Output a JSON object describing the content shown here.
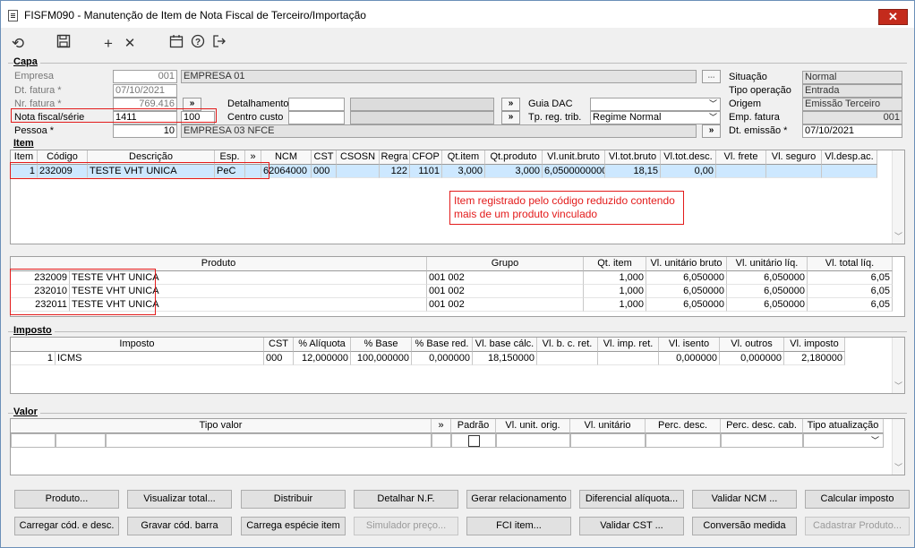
{
  "window": {
    "title": "FISFM090 - Manutenção de Item de Nota Fiscal de Terceiro/Importação",
    "close": "✕"
  },
  "toolbar": {
    "refresh": "⟲",
    "save": "💾",
    "add": "+",
    "cancel": "✕",
    "calendar": "▦",
    "help": "?",
    "exit": "⇥"
  },
  "capa": {
    "title": "Capa",
    "empresa": {
      "label": "Empresa",
      "code": "001",
      "name": "EMPRESA 01",
      "btn": "..."
    },
    "dt_fatura": {
      "label": "Dt. fatura *",
      "value": "07/10/2021"
    },
    "nr_fatura": {
      "label": "Nr. fatura *",
      "value": "769.416",
      "btn": "»"
    },
    "nota_fiscal": {
      "label": "Nota fiscal/série",
      "value": "1411",
      "serie": "100"
    },
    "pessoa": {
      "label": "Pessoa *",
      "value": "10",
      "name": "EMPRESA 03 NFCE",
      "btn": "»"
    },
    "detalhamento": {
      "label": "Detalhamento",
      "btn": "»"
    },
    "centro_custo": {
      "label": "Centro custo",
      "btn": "»"
    },
    "guia_dac": {
      "label": "Guia DAC",
      "value": ""
    },
    "tp_reg_trib": {
      "label": "Tp. reg. trib.",
      "value": "Regime Normal"
    },
    "situacao": {
      "label": "Situação",
      "value": "Normal"
    },
    "tipo_operacao": {
      "label": "Tipo operação",
      "value": "Entrada"
    },
    "origem": {
      "label": "Origem",
      "value": "Emissão Terceiro"
    },
    "emp_fatura": {
      "label": "Emp. fatura",
      "value": "001"
    },
    "dt_emissao": {
      "label": "Dt. emissão *",
      "value": "07/10/2021"
    }
  },
  "item": {
    "title": "Item",
    "columns": [
      "Item",
      "Código",
      "Descrição",
      "Esp.",
      "»",
      "NCM",
      "CST",
      "CSOSN",
      "Regra",
      "CFOP",
      "Qt.item",
      "Qt.produto",
      "Vl.unit.bruto",
      "Vl.tot.bruto",
      "Vl.tot.desc.",
      "Vl. frete",
      "Vl. seguro",
      "Vl.desp.ac."
    ],
    "rows": [
      [
        "1",
        "232009",
        "TESTE VHT UNICA",
        "PeC",
        "",
        "62064000",
        "000",
        "",
        "122",
        "1101",
        "3,000",
        "3,000",
        "6,0500000000",
        "18,15",
        "0,00",
        "",
        "",
        ""
      ]
    ],
    "note": "Item registrado pelo código reduzido contendo mais de um produto vinculado"
  },
  "produtos": {
    "columns": [
      "Produto",
      "Grupo",
      "Qt. item",
      "Vl. unitário bruto",
      "Vl. unitário líq.",
      "Vl. total líq."
    ],
    "rows": [
      [
        "232009",
        "TESTE VHT UNICA",
        "001 002",
        "1,000",
        "6,050000",
        "6,050000",
        "6,05"
      ],
      [
        "232010",
        "TESTE VHT UNICA",
        "001 002",
        "1,000",
        "6,050000",
        "6,050000",
        "6,05"
      ],
      [
        "232011",
        "TESTE VHT UNICA",
        "001 002",
        "1,000",
        "6,050000",
        "6,050000",
        "6,05"
      ]
    ]
  },
  "imposto": {
    "title": "Imposto",
    "columns": [
      "Imposto",
      "CST",
      "% Alíquota",
      "% Base",
      "% Base red.",
      "Vl. base cálc.",
      "Vl. b. c. ret.",
      "Vl. imp. ret.",
      "Vl. isento",
      "Vl. outros",
      "Vl. imposto"
    ],
    "rows": [
      [
        "1",
        "ICMS",
        "000",
        "12,000000",
        "100,000000",
        "0,000000",
        "18,150000",
        "",
        "",
        "0,000000",
        "0,000000",
        "2,180000"
      ]
    ]
  },
  "valor": {
    "title": "Valor",
    "columns": [
      "Tipo valor",
      "»",
      "Padrão",
      "Vl. unit. orig.",
      "Vl. unitário",
      "Perc. desc.",
      "Perc. desc. cab.",
      "Tipo atualização"
    ]
  },
  "actions": {
    "row1": [
      "Produto...",
      "Visualizar total...",
      "Distribuir",
      "Detalhar N.F.",
      "Gerar relacionamento",
      "Diferencial alíquota...",
      "Validar NCM ...",
      "Calcular imposto"
    ],
    "row2": [
      "Carregar cód. e desc.",
      "Gravar cód. barra",
      "Carrega espécie item",
      "Simulador preço...",
      "FCI item...",
      "Validar CST ...",
      "Conversão medida",
      "Cadastrar Produto..."
    ],
    "row2_disabled": [
      false,
      false,
      false,
      true,
      false,
      false,
      false,
      true
    ]
  }
}
